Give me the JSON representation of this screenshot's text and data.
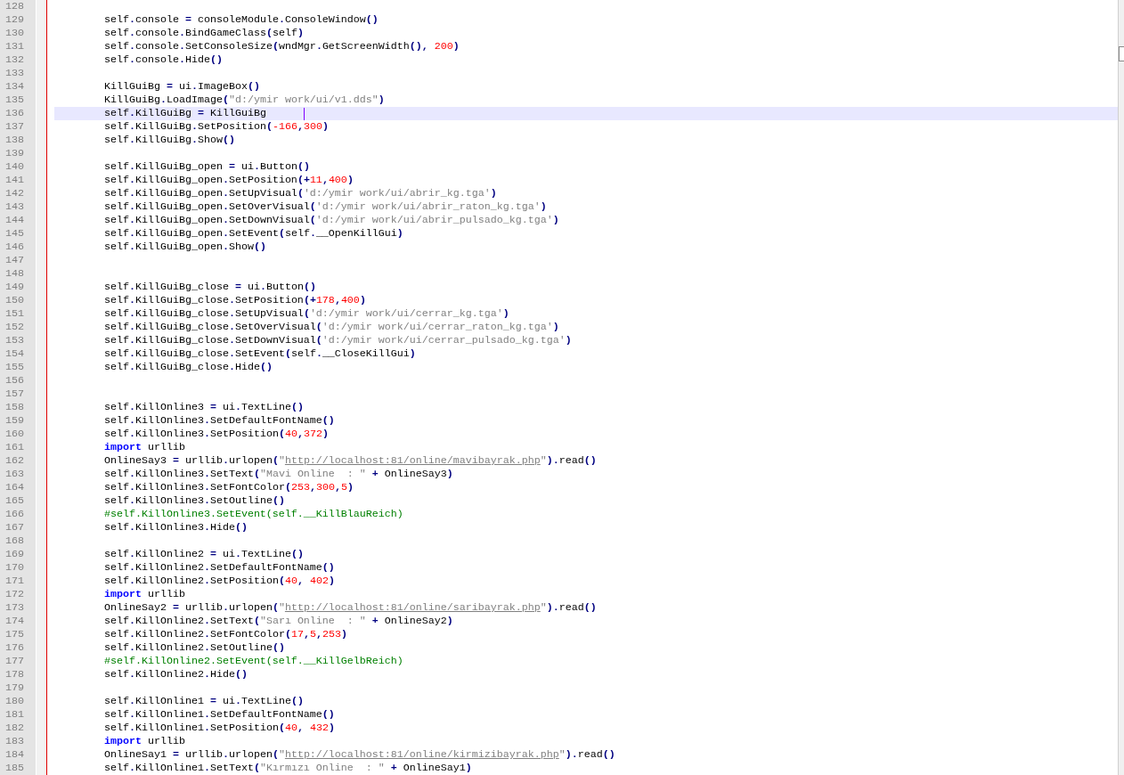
{
  "editor": {
    "lines": [
      {
        "number": "128",
        "current": false
      },
      {
        "number": "129",
        "current": false,
        "tokens": [
          {
            "kind": "plain",
            "text": "self.console = consoleModule.ConsoleWindow()"
          }
        ]
      },
      {
        "number": "130",
        "current": false,
        "tokens": [
          {
            "kind": "plain",
            "text": "self.console.BindGameClass(self)"
          }
        ]
      },
      {
        "number": "131",
        "current": false,
        "tokens": [
          {
            "kind": "plain",
            "text": "self.console.SetConsoleSize(wndMgr.GetScreenWidth(), "
          },
          {
            "kind": "number",
            "text": "200"
          },
          {
            "kind": "plain",
            "text": ")"
          }
        ]
      },
      {
        "number": "132",
        "current": false,
        "tokens": [
          {
            "kind": "plain",
            "text": "self.console.Hide()"
          }
        ]
      },
      {
        "number": "133",
        "current": false
      },
      {
        "number": "134",
        "current": false,
        "tokens": [
          {
            "kind": "plain",
            "text": "KillGuiBg = ui.ImageBox()"
          }
        ]
      },
      {
        "number": "135",
        "current": false,
        "tokens": [
          {
            "kind": "plain",
            "text": "KillGuiBg.LoadImage("
          },
          {
            "kind": "string",
            "text": "\"d:/ymir work/ui/v1.dds\""
          },
          {
            "kind": "plain",
            "text": ")"
          }
        ]
      },
      {
        "number": "136",
        "current": true,
        "tokens": [
          {
            "kind": "plain",
            "text": "self.KillGuiBg = KillGuiBg"
          }
        ]
      },
      {
        "number": "137",
        "current": false,
        "tokens": [
          {
            "kind": "plain",
            "text": "self.KillGuiBg.SetPosition("
          },
          {
            "kind": "number",
            "text": "-166"
          },
          {
            "kind": "plain",
            "text": ","
          },
          {
            "kind": "number",
            "text": "300"
          },
          {
            "kind": "plain",
            "text": ")"
          }
        ]
      },
      {
        "number": "138",
        "current": false,
        "tokens": [
          {
            "kind": "plain",
            "text": "self.KillGuiBg.Show()"
          }
        ]
      },
      {
        "number": "139",
        "current": false
      },
      {
        "number": "140",
        "current": false,
        "tokens": [
          {
            "kind": "plain",
            "text": "self.KillGuiBg_open = ui.Button()"
          }
        ]
      },
      {
        "number": "141",
        "current": false,
        "tokens": [
          {
            "kind": "plain",
            "text": "self.KillGuiBg_open.SetPosition(+"
          },
          {
            "kind": "number",
            "text": "11"
          },
          {
            "kind": "plain",
            "text": ","
          },
          {
            "kind": "number",
            "text": "400"
          },
          {
            "kind": "plain",
            "text": ")"
          }
        ]
      },
      {
        "number": "142",
        "current": false,
        "tokens": [
          {
            "kind": "plain",
            "text": "self.KillGuiBg_open.SetUpVisual("
          },
          {
            "kind": "string",
            "text": "'d:/ymir work/ui/abrir_kg.tga'"
          },
          {
            "kind": "plain",
            "text": ")"
          }
        ]
      },
      {
        "number": "143",
        "current": false,
        "tokens": [
          {
            "kind": "plain",
            "text": "self.KillGuiBg_open.SetOverVisual("
          },
          {
            "kind": "string",
            "text": "'d:/ymir work/ui/abrir_raton_kg.tga'"
          },
          {
            "kind": "plain",
            "text": ")"
          }
        ]
      },
      {
        "number": "144",
        "current": false,
        "tokens": [
          {
            "kind": "plain",
            "text": "self.KillGuiBg_open.SetDownVisual("
          },
          {
            "kind": "string",
            "text": "'d:/ymir work/ui/abrir_pulsado_kg.tga'"
          },
          {
            "kind": "plain",
            "text": ")"
          }
        ]
      },
      {
        "number": "145",
        "current": false,
        "tokens": [
          {
            "kind": "plain",
            "text": "self.KillGuiBg_open.SetEvent(self.__OpenKillGui)"
          }
        ]
      },
      {
        "number": "146",
        "current": false,
        "tokens": [
          {
            "kind": "plain",
            "text": "self.KillGuiBg_open.Show()"
          }
        ]
      },
      {
        "number": "147",
        "current": false
      },
      {
        "number": "148",
        "current": false
      },
      {
        "number": "149",
        "current": false,
        "tokens": [
          {
            "kind": "plain",
            "text": "self.KillGuiBg_close = ui.Button()"
          }
        ]
      },
      {
        "number": "150",
        "current": false,
        "tokens": [
          {
            "kind": "plain",
            "text": "self.KillGuiBg_close.SetPosition(+"
          },
          {
            "kind": "number",
            "text": "178"
          },
          {
            "kind": "plain",
            "text": ","
          },
          {
            "kind": "number",
            "text": "400"
          },
          {
            "kind": "plain",
            "text": ")"
          }
        ]
      },
      {
        "number": "151",
        "current": false,
        "tokens": [
          {
            "kind": "plain",
            "text": "self.KillGuiBg_close.SetUpVisual("
          },
          {
            "kind": "string",
            "text": "'d:/ymir work/ui/cerrar_kg.tga'"
          },
          {
            "kind": "plain",
            "text": ")"
          }
        ]
      },
      {
        "number": "152",
        "current": false,
        "tokens": [
          {
            "kind": "plain",
            "text": "self.KillGuiBg_close.SetOverVisual("
          },
          {
            "kind": "string",
            "text": "'d:/ymir work/ui/cerrar_raton_kg.tga'"
          },
          {
            "kind": "plain",
            "text": ")"
          }
        ]
      },
      {
        "number": "153",
        "current": false,
        "tokens": [
          {
            "kind": "plain",
            "text": "self.KillGuiBg_close.SetDownVisual("
          },
          {
            "kind": "string",
            "text": "'d:/ymir work/ui/cerrar_pulsado_kg.tga'"
          },
          {
            "kind": "plain",
            "text": ")"
          }
        ]
      },
      {
        "number": "154",
        "current": false,
        "tokens": [
          {
            "kind": "plain",
            "text": "self.KillGuiBg_close.SetEvent(self.__CloseKillGui)"
          }
        ]
      },
      {
        "number": "155",
        "current": false,
        "tokens": [
          {
            "kind": "plain",
            "text": "self.KillGuiBg_close.Hide()"
          }
        ]
      },
      {
        "number": "156",
        "current": false
      },
      {
        "number": "157",
        "current": false
      },
      {
        "number": "158",
        "current": false,
        "tokens": [
          {
            "kind": "plain",
            "text": "self.KillOnline3 = ui.TextLine()"
          }
        ]
      },
      {
        "number": "159",
        "current": false,
        "tokens": [
          {
            "kind": "plain",
            "text": "self.KillOnline3.SetDefaultFontName()"
          }
        ]
      },
      {
        "number": "160",
        "current": false,
        "tokens": [
          {
            "kind": "plain",
            "text": "self.KillOnline3.SetPosition("
          },
          {
            "kind": "number",
            "text": "40"
          },
          {
            "kind": "plain",
            "text": ","
          },
          {
            "kind": "number",
            "text": "372"
          },
          {
            "kind": "plain",
            "text": ")"
          }
        ]
      },
      {
        "number": "161",
        "current": false,
        "tokens": [
          {
            "kind": "keyword",
            "text": "import"
          },
          {
            "kind": "plain",
            "text": " urllib"
          }
        ]
      },
      {
        "number": "162",
        "current": false,
        "tokens": [
          {
            "kind": "plain",
            "text": "OnlineSay3 = urllib.urlopen("
          },
          {
            "kind": "string",
            "text": "\""
          },
          {
            "kind": "url",
            "text": "http://localhost:81/online/mavibayrak.php"
          },
          {
            "kind": "string",
            "text": "\""
          },
          {
            "kind": "plain",
            "text": ").read()"
          }
        ]
      },
      {
        "number": "163",
        "current": false,
        "tokens": [
          {
            "kind": "plain",
            "text": "self.KillOnline3.SetText("
          },
          {
            "kind": "string",
            "text": "\"Mavi Online  : \""
          },
          {
            "kind": "plain",
            "text": " + OnlineSay3)"
          }
        ]
      },
      {
        "number": "164",
        "current": false,
        "tokens": [
          {
            "kind": "plain",
            "text": "self.KillOnline3.SetFontColor("
          },
          {
            "kind": "number",
            "text": "253"
          },
          {
            "kind": "plain",
            "text": ","
          },
          {
            "kind": "number",
            "text": "300"
          },
          {
            "kind": "plain",
            "text": ","
          },
          {
            "kind": "number",
            "text": "5"
          },
          {
            "kind": "plain",
            "text": ")"
          }
        ]
      },
      {
        "number": "165",
        "current": false,
        "tokens": [
          {
            "kind": "plain",
            "text": "self.KillOnline3.SetOutline()"
          }
        ]
      },
      {
        "number": "166",
        "current": false,
        "tokens": [
          {
            "kind": "comment",
            "text": "#self.KillOnline3.SetEvent(self.__KillBlauReich)"
          }
        ]
      },
      {
        "number": "167",
        "current": false,
        "tokens": [
          {
            "kind": "plain",
            "text": "self.KillOnline3.Hide()"
          }
        ]
      },
      {
        "number": "168",
        "current": false
      },
      {
        "number": "169",
        "current": false,
        "tokens": [
          {
            "kind": "plain",
            "text": "self.KillOnline2 = ui.TextLine()"
          }
        ]
      },
      {
        "number": "170",
        "current": false,
        "tokens": [
          {
            "kind": "plain",
            "text": "self.KillOnline2.SetDefaultFontName()"
          }
        ]
      },
      {
        "number": "171",
        "current": false,
        "tokens": [
          {
            "kind": "plain",
            "text": "self.KillOnline2.SetPosition("
          },
          {
            "kind": "number",
            "text": "40"
          },
          {
            "kind": "plain",
            "text": ", "
          },
          {
            "kind": "number",
            "text": "402"
          },
          {
            "kind": "plain",
            "text": ")"
          }
        ]
      },
      {
        "number": "172",
        "current": false,
        "tokens": [
          {
            "kind": "keyword",
            "text": "import"
          },
          {
            "kind": "plain",
            "text": " urllib"
          }
        ]
      },
      {
        "number": "173",
        "current": false,
        "tokens": [
          {
            "kind": "plain",
            "text": "OnlineSay2 = urllib.urlopen("
          },
          {
            "kind": "string",
            "text": "\""
          },
          {
            "kind": "url",
            "text": "http://localhost:81/online/saribayrak.php"
          },
          {
            "kind": "string",
            "text": "\""
          },
          {
            "kind": "plain",
            "text": ").read()"
          }
        ]
      },
      {
        "number": "174",
        "current": false,
        "tokens": [
          {
            "kind": "plain",
            "text": "self.KillOnline2.SetText("
          },
          {
            "kind": "string",
            "text": "\"Sarı Online  : \""
          },
          {
            "kind": "plain",
            "text": " + OnlineSay2)"
          }
        ]
      },
      {
        "number": "175",
        "current": false,
        "tokens": [
          {
            "kind": "plain",
            "text": "self.KillOnline2.SetFontColor("
          },
          {
            "kind": "number",
            "text": "17"
          },
          {
            "kind": "plain",
            "text": ","
          },
          {
            "kind": "number",
            "text": "5"
          },
          {
            "kind": "plain",
            "text": ","
          },
          {
            "kind": "number",
            "text": "253"
          },
          {
            "kind": "plain",
            "text": ")"
          }
        ]
      },
      {
        "number": "176",
        "current": false,
        "tokens": [
          {
            "kind": "plain",
            "text": "self.KillOnline2.SetOutline()"
          }
        ]
      },
      {
        "number": "177",
        "current": false,
        "tokens": [
          {
            "kind": "comment",
            "text": "#self.KillOnline2.SetEvent(self.__KillGelbReich)"
          }
        ]
      },
      {
        "number": "178",
        "current": false,
        "tokens": [
          {
            "kind": "plain",
            "text": "self.KillOnline2.Hide()"
          }
        ]
      },
      {
        "number": "179",
        "current": false
      },
      {
        "number": "180",
        "current": false,
        "tokens": [
          {
            "kind": "plain",
            "text": "self.KillOnline1 = ui.TextLine()"
          }
        ]
      },
      {
        "number": "181",
        "current": false,
        "tokens": [
          {
            "kind": "plain",
            "text": "self.KillOnline1.SetDefaultFontName()"
          }
        ]
      },
      {
        "number": "182",
        "current": false,
        "tokens": [
          {
            "kind": "plain",
            "text": "self.KillOnline1.SetPosition("
          },
          {
            "kind": "number",
            "text": "40"
          },
          {
            "kind": "plain",
            "text": ", "
          },
          {
            "kind": "number",
            "text": "432"
          },
          {
            "kind": "plain",
            "text": ")"
          }
        ]
      },
      {
        "number": "183",
        "current": false,
        "tokens": [
          {
            "kind": "keyword",
            "text": "import"
          },
          {
            "kind": "plain",
            "text": " urllib"
          }
        ]
      },
      {
        "number": "184",
        "current": false,
        "tokens": [
          {
            "kind": "plain",
            "text": "OnlineSay1 = urllib.urlopen("
          },
          {
            "kind": "string",
            "text": "\""
          },
          {
            "kind": "url",
            "text": "http://localhost:81/online/kirmizibayrak.php"
          },
          {
            "kind": "string",
            "text": "\""
          },
          {
            "kind": "plain",
            "text": ").read()"
          }
        ]
      },
      {
        "number": "185",
        "current": false,
        "tokens": [
          {
            "kind": "plain",
            "text": "self.KillOnline1.SetText("
          },
          {
            "kind": "string",
            "text": "\"Kırmızı Online  : \""
          },
          {
            "kind": "plain",
            "text": " + OnlineSay1)"
          }
        ]
      }
    ]
  }
}
